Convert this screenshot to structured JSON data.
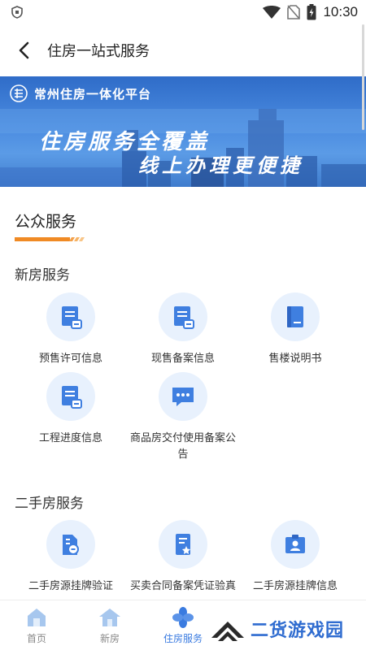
{
  "status_bar": {
    "time": "10:30"
  },
  "header": {
    "title": "住房一站式服务"
  },
  "banner": {
    "platform_name": "常州住房一体化平台",
    "line1": "住房服务全覆盖",
    "line2": "线上办理更便捷"
  },
  "public_services": {
    "title": "公众服务",
    "new_house": {
      "title": "新房服务",
      "items": [
        {
          "label": "预售许可信息",
          "icon": "document-stamp-icon"
        },
        {
          "label": "现售备案信息",
          "icon": "document-stamp-icon"
        },
        {
          "label": "售楼说明书",
          "icon": "book-icon"
        },
        {
          "label": "工程进度信息",
          "icon": "document-stamp-icon"
        },
        {
          "label": "商品房交付使用备案公告",
          "icon": "chat-bubble-icon"
        }
      ]
    },
    "second_hand": {
      "title": "二手房服务",
      "items": [
        {
          "label": "二手房源挂牌验证",
          "icon": "building-certificate-icon"
        },
        {
          "label": "买卖合同备案凭证验真",
          "icon": "contract-star-icon"
        },
        {
          "label": "二手房源挂牌信息",
          "icon": "id-card-icon"
        }
      ]
    }
  },
  "bottom_nav": {
    "items": [
      {
        "label": "首页",
        "icon": "home-icon"
      },
      {
        "label": "新房",
        "icon": "house-icon"
      },
      {
        "label": "住房服务",
        "icon": "four-petal-icon",
        "active": true
      }
    ]
  },
  "watermark": {
    "text": "二货游戏园"
  },
  "colors": {
    "accent": "#3a7be0",
    "tile_bg": "#e8f1fd",
    "underline": "#f08a24"
  }
}
